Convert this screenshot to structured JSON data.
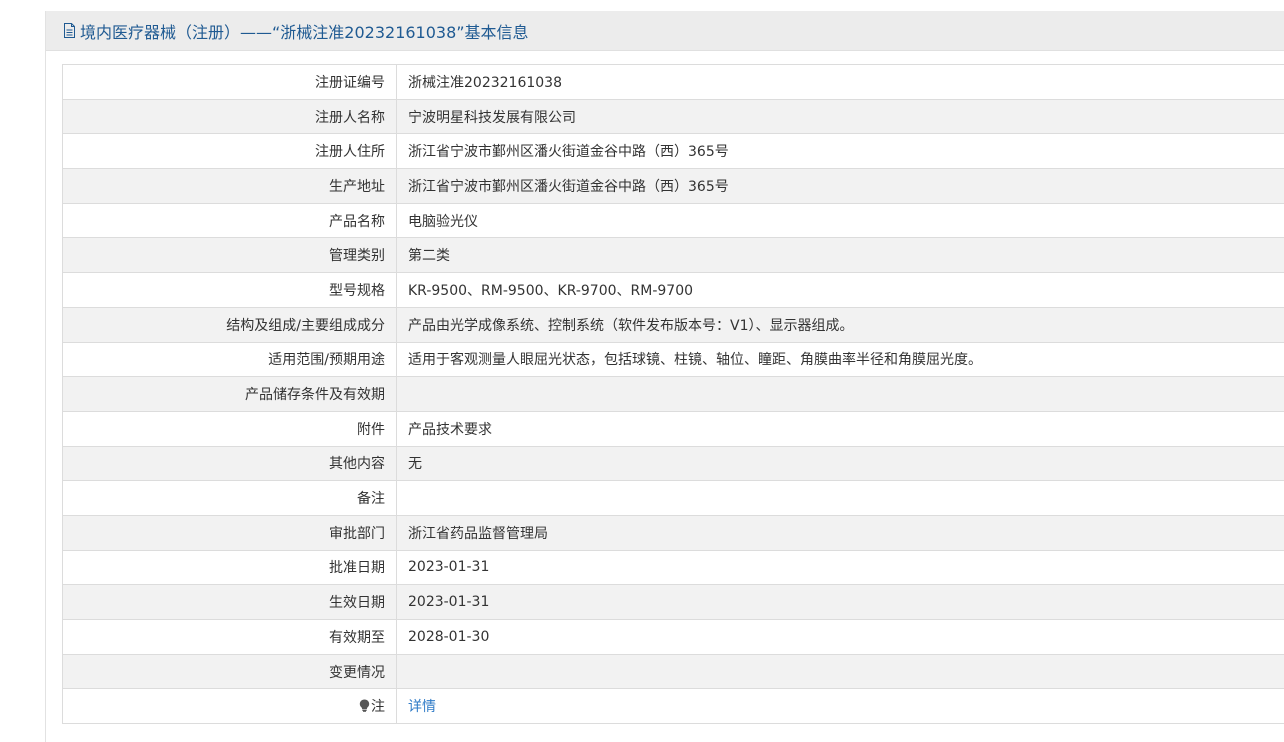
{
  "header": {
    "title": "境内医疗器械（注册）——“浙械注准20232161038”基本信息",
    "icon": "document-icon"
  },
  "rows": [
    {
      "label": "注册证编号",
      "value": "浙械注准20232161038"
    },
    {
      "label": "注册人名称",
      "value": "宁波明星科技发展有限公司"
    },
    {
      "label": "注册人住所",
      "value": "浙江省宁波市鄞州区潘火街道金谷中路（西）365号"
    },
    {
      "label": "生产地址",
      "value": "浙江省宁波市鄞州区潘火街道金谷中路（西）365号"
    },
    {
      "label": "产品名称",
      "value": "电脑验光仪"
    },
    {
      "label": "管理类别",
      "value": "第二类"
    },
    {
      "label": "型号规格",
      "value": "KR-9500、RM-9500、KR-9700、RM-9700"
    },
    {
      "label": "结构及组成/主要组成成分",
      "value": "产品由光学成像系统、控制系统（软件发布版本号：V1）、显示器组成。"
    },
    {
      "label": "适用范围/预期用途",
      "value": "适用于客观测量人眼屈光状态，包括球镜、柱镜、轴位、瞳距、角膜曲率半径和角膜屈光度。"
    },
    {
      "label": "产品储存条件及有效期",
      "value": ""
    },
    {
      "label": "附件",
      "value": "产品技术要求"
    },
    {
      "label": "其他内容",
      "value": "无"
    },
    {
      "label": "备注",
      "value": ""
    },
    {
      "label": "审批部门",
      "value": "浙江省药品监督管理局"
    },
    {
      "label": "批准日期",
      "value": "2023-01-31"
    },
    {
      "label": "生效日期",
      "value": "2023-01-31"
    },
    {
      "label": "有效期至",
      "value": "2028-01-30"
    },
    {
      "label": "变更情况",
      "value": ""
    }
  ],
  "note": {
    "label": "注",
    "icon": "lightbulb-icon",
    "link_text": "详情"
  },
  "colors": {
    "title": "#1f5a92",
    "link": "#2f7bc7",
    "header_bg": "#ececec",
    "stripe_bg": "#f2f2f2"
  }
}
